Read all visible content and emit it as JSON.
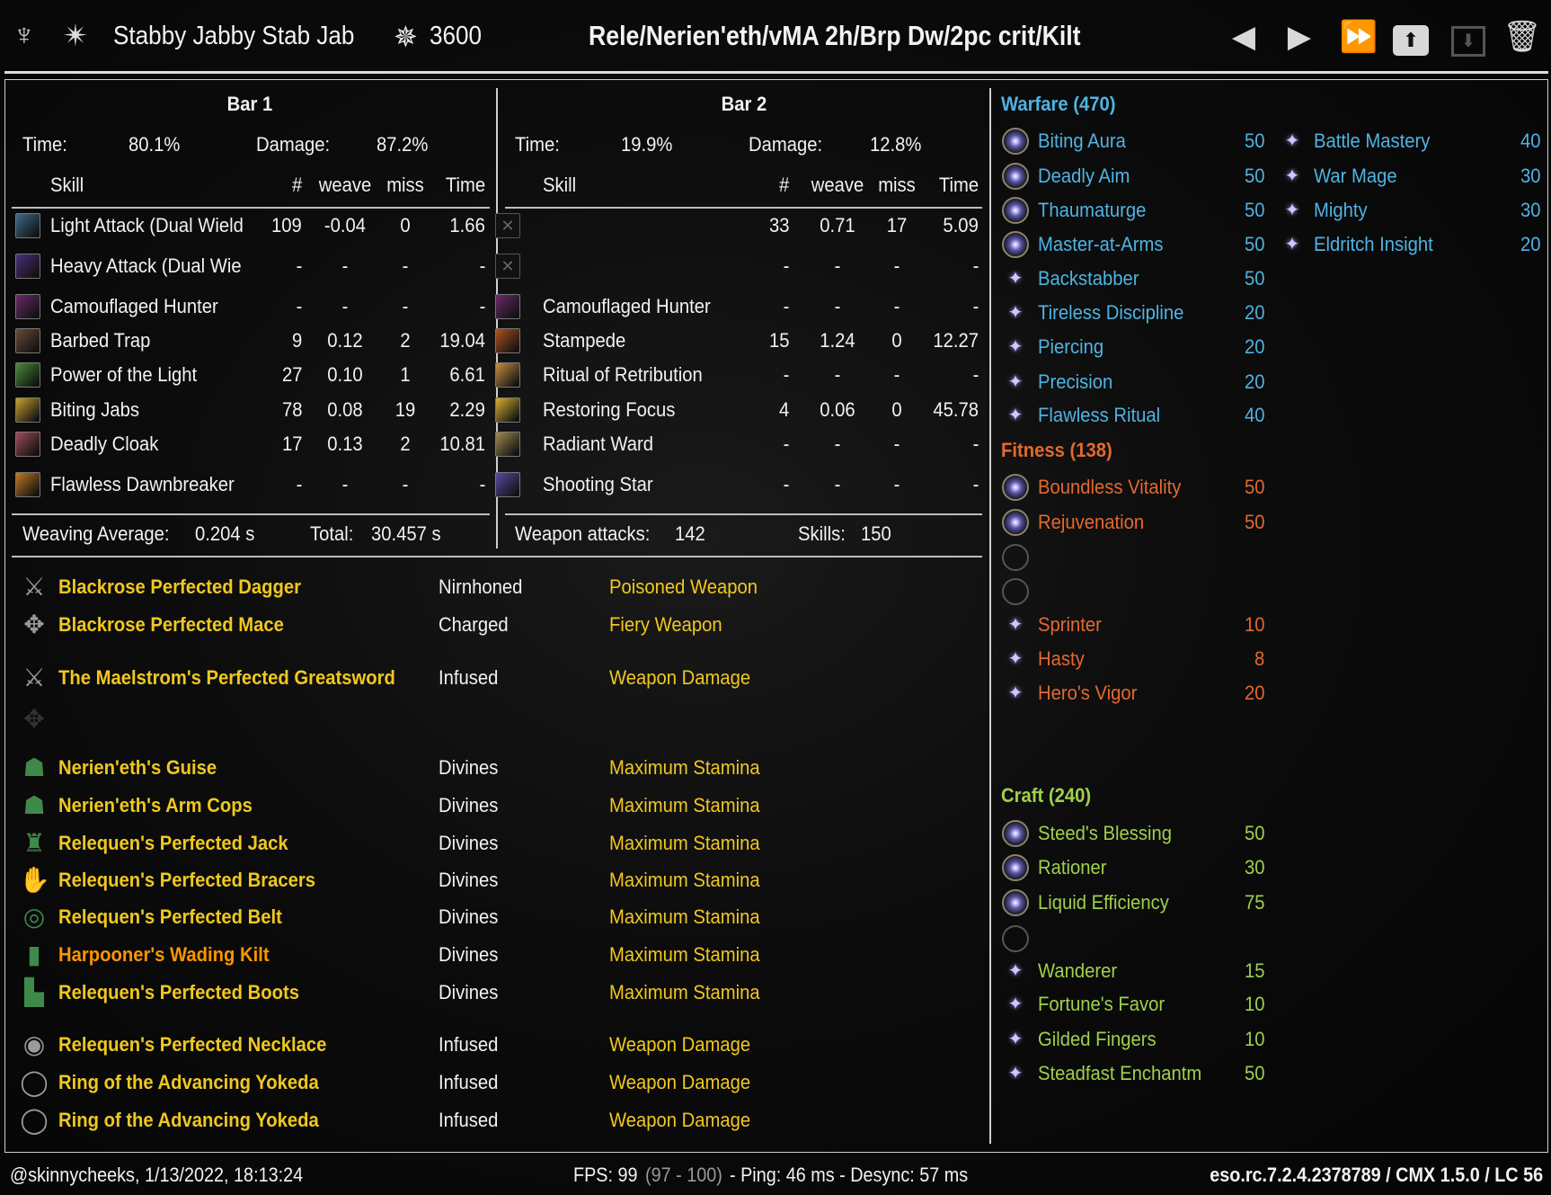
{
  "header": {
    "character_name": "Stabby Jabby Stab Jab",
    "champion_points": "3600",
    "setup_title": "Rele/Nerien'eth/vMA 2h/Brp Dw/2pc crit/Kilt",
    "icons": [
      "class-emblem-icon",
      "star-icon",
      "champion-icon"
    ],
    "buttons": [
      "previous-icon",
      "next-icon",
      "fast-forward-icon",
      "upload-icon",
      "download-icon",
      "trash-icon"
    ]
  },
  "bars": [
    {
      "title": "Bar 1",
      "time_label": "Time:",
      "time": "80.1%",
      "damage_label": "Damage:",
      "damage": "87.2%",
      "headers": {
        "skill": "Skill",
        "count": "#",
        "weave": "weave",
        "miss": "miss",
        "time": "Time"
      },
      "skills": [
        {
          "name": "Light Attack (Dual Wield",
          "count": "109",
          "weave": "-0.04",
          "miss": "0",
          "time": "1.66",
          "color": "#3d6a8a"
        },
        {
          "name": "Heavy Attack (Dual Wie",
          "count": "-",
          "weave": "-",
          "miss": "-",
          "time": "-",
          "color": "#4a2e7a"
        },
        {
          "name": "Camouflaged Hunter",
          "count": "-",
          "weave": "-",
          "miss": "-",
          "time": "-",
          "color": "#6a2a6a"
        },
        {
          "name": "Barbed Trap",
          "count": "9",
          "weave": "0.12",
          "miss": "2",
          "time": "19.04",
          "color": "#6a4a3a"
        },
        {
          "name": "Power of the Light",
          "count": "27",
          "weave": "0.10",
          "miss": "1",
          "time": "6.61",
          "color": "#4a8a3a"
        },
        {
          "name": "Biting Jabs",
          "count": "78",
          "weave": "0.08",
          "miss": "19",
          "time": "2.29",
          "color": "#c8a030"
        },
        {
          "name": "Deadly Cloak",
          "count": "17",
          "weave": "0.13",
          "miss": "2",
          "time": "10.81",
          "color": "#a04a5a"
        },
        {
          "name": "Flawless Dawnbreaker",
          "count": "-",
          "weave": "-",
          "miss": "-",
          "time": "-",
          "color": "#c07a20"
        }
      ],
      "summary": {
        "label1": "Weaving Average:",
        "value1": "0.204 s",
        "label2": "Total:",
        "value2": "30.457 s"
      }
    },
    {
      "title": "Bar 2",
      "time_label": "Time:",
      "time": "19.9%",
      "damage_label": "Damage:",
      "damage": "12.8%",
      "headers": {
        "skill": "Skill",
        "count": "#",
        "weave": "weave",
        "miss": "miss",
        "time": "Time"
      },
      "skills": [
        {
          "name": "",
          "count": "33",
          "weave": "0.71",
          "miss": "17",
          "time": "5.09",
          "color": "empty"
        },
        {
          "name": "",
          "count": "-",
          "weave": "-",
          "miss": "-",
          "time": "-",
          "color": "empty"
        },
        {
          "name": "Camouflaged Hunter",
          "count": "-",
          "weave": "-",
          "miss": "-",
          "time": "-",
          "color": "#6a2a6a"
        },
        {
          "name": "Stampede",
          "count": "15",
          "weave": "1.24",
          "miss": "0",
          "time": "12.27",
          "color": "#b05020"
        },
        {
          "name": "Ritual of Retribution",
          "count": "-",
          "weave": "-",
          "miss": "-",
          "time": "-",
          "color": "#c89040"
        },
        {
          "name": "Restoring Focus",
          "count": "4",
          "weave": "0.06",
          "miss": "0",
          "time": "45.78",
          "color": "#d8b030"
        },
        {
          "name": "Radiant Ward",
          "count": "-",
          "weave": "-",
          "miss": "-",
          "time": "-",
          "color": "#a08a50"
        },
        {
          "name": "Shooting Star",
          "count": "-",
          "weave": "-",
          "miss": "-",
          "time": "-",
          "color": "#5a4aa0"
        }
      ],
      "summary": {
        "label1": "Weapon attacks:",
        "value1": "142",
        "label2": "Skills:",
        "value2": "150"
      }
    }
  ],
  "gear": [
    {
      "name": "Blackrose Perfected Dagger",
      "trait": "Nirnhoned",
      "enchant": "Poisoned Weapon",
      "icon": "dagger-icon",
      "color": "#f0c81e"
    },
    {
      "name": "Blackrose Perfected Mace",
      "trait": "Charged",
      "enchant": "Fiery Weapon",
      "icon": "mace-icon",
      "color": "#f0c81e"
    },
    {
      "name": "The Maelstrom's Perfected Greatsword",
      "trait": "Infused",
      "enchant": "Weapon Damage",
      "icon": "greatsword-icon",
      "color": "#f0c81e"
    },
    {
      "name": "",
      "trait": "",
      "enchant": "",
      "icon": "empty-offhand-icon",
      "color": "#f0c81e"
    },
    {
      "name": "Nerien'eth's Guise",
      "trait": "Divines",
      "enchant": "Maximum Stamina",
      "icon": "helmet-icon",
      "color": "#f0c81e"
    },
    {
      "name": "Nerien'eth's Arm Cops",
      "trait": "Divines",
      "enchant": "Maximum Stamina",
      "icon": "shoulders-icon",
      "color": "#f0c81e"
    },
    {
      "name": "Relequen's Perfected Jack",
      "trait": "Divines",
      "enchant": "Maximum Stamina",
      "icon": "chest-icon",
      "color": "#f0c81e"
    },
    {
      "name": "Relequen's Perfected Bracers",
      "trait": "Divines",
      "enchant": "Maximum Stamina",
      "icon": "gloves-icon",
      "color": "#f0c81e"
    },
    {
      "name": "Relequen's Perfected Belt",
      "trait": "Divines",
      "enchant": "Maximum Stamina",
      "icon": "belt-icon",
      "color": "#f0c81e"
    },
    {
      "name": "Harpooner's Wading Kilt",
      "trait": "Divines",
      "enchant": "Maximum Stamina",
      "icon": "legs-icon",
      "color": "#ff9500"
    },
    {
      "name": "Relequen's Perfected Boots",
      "trait": "Divines",
      "enchant": "Maximum Stamina",
      "icon": "boots-icon",
      "color": "#f0c81e"
    },
    {
      "name": "Relequen's Perfected Necklace",
      "trait": "Infused",
      "enchant": "Weapon Damage",
      "icon": "necklace-icon",
      "color": "#f0c81e"
    },
    {
      "name": "Ring of the Advancing Yokeda",
      "trait": "Infused",
      "enchant": "Weapon Damage",
      "icon": "ring-icon",
      "color": "#f0c81e"
    },
    {
      "name": "Ring of the Advancing Yokeda",
      "trait": "Infused",
      "enchant": "Weapon Damage",
      "icon": "ring-icon",
      "color": "#f0c81e"
    }
  ],
  "champion": [
    {
      "title": "Warfare (470)",
      "color": "#4fb3e3",
      "items": [
        {
          "type": "slotted",
          "name": "Biting Aura",
          "value": "50"
        },
        {
          "type": "slotted",
          "name": "Deadly Aim",
          "value": "50"
        },
        {
          "type": "slotted",
          "name": "Thaumaturge",
          "value": "50"
        },
        {
          "type": "slotted",
          "name": "Master-at-Arms",
          "value": "50"
        },
        {
          "type": "passive",
          "name": "Backstabber",
          "value": "50"
        },
        {
          "type": "passive",
          "name": "Tireless Discipline",
          "value": "20"
        },
        {
          "type": "passive",
          "name": "Piercing",
          "value": "20"
        },
        {
          "type": "passive",
          "name": "Precision",
          "value": "20"
        },
        {
          "type": "passive",
          "name": "Flawless Ritual",
          "value": "40"
        }
      ],
      "items2": [
        {
          "type": "passive",
          "name": "Battle Mastery",
          "value": "40"
        },
        {
          "type": "passive",
          "name": "War Mage",
          "value": "30"
        },
        {
          "type": "passive",
          "name": "Mighty",
          "value": "30"
        },
        {
          "type": "passive",
          "name": "Eldritch Insight",
          "value": "20"
        }
      ]
    },
    {
      "title": "Fitness (138)",
      "color": "#e4692f",
      "items": [
        {
          "type": "slotted",
          "name": "Boundless Vitality",
          "value": "50"
        },
        {
          "type": "slotted",
          "name": "Rejuvenation",
          "value": "50"
        },
        {
          "type": "empty",
          "name": "",
          "value": ""
        },
        {
          "type": "empty",
          "name": "",
          "value": ""
        },
        {
          "type": "passive",
          "name": "Sprinter",
          "value": "10"
        },
        {
          "type": "passive",
          "name": "Hasty",
          "value": "8"
        },
        {
          "type": "passive",
          "name": "Hero's Vigor",
          "value": "20"
        }
      ]
    },
    {
      "title": "Craft (240)",
      "color": "#9fd14a",
      "items": [
        {
          "type": "slotted",
          "name": "Steed's Blessing",
          "value": "50"
        },
        {
          "type": "slotted",
          "name": "Rationer",
          "value": "30"
        },
        {
          "type": "slotted",
          "name": "Liquid Efficiency",
          "value": "75"
        },
        {
          "type": "empty",
          "name": "",
          "value": ""
        },
        {
          "type": "passive",
          "name": "Wanderer",
          "value": "15"
        },
        {
          "type": "passive",
          "name": "Fortune's Favor",
          "value": "10"
        },
        {
          "type": "passive",
          "name": "Gilded Fingers",
          "value": "10"
        },
        {
          "type": "passive",
          "name": "Steadfast Enchantm",
          "value": "50"
        }
      ]
    }
  ],
  "footer": {
    "user_time": "@skinnycheeks, 1/13/2022, 18:13:24",
    "fps": "FPS: 99",
    "fps_range": "(97 - 100)",
    "net": "- Ping: 46 ms - Desync: 57 ms",
    "version": "eso.rc.7.2.4.2378789 / CMX 1.5.0 / LC 56"
  }
}
